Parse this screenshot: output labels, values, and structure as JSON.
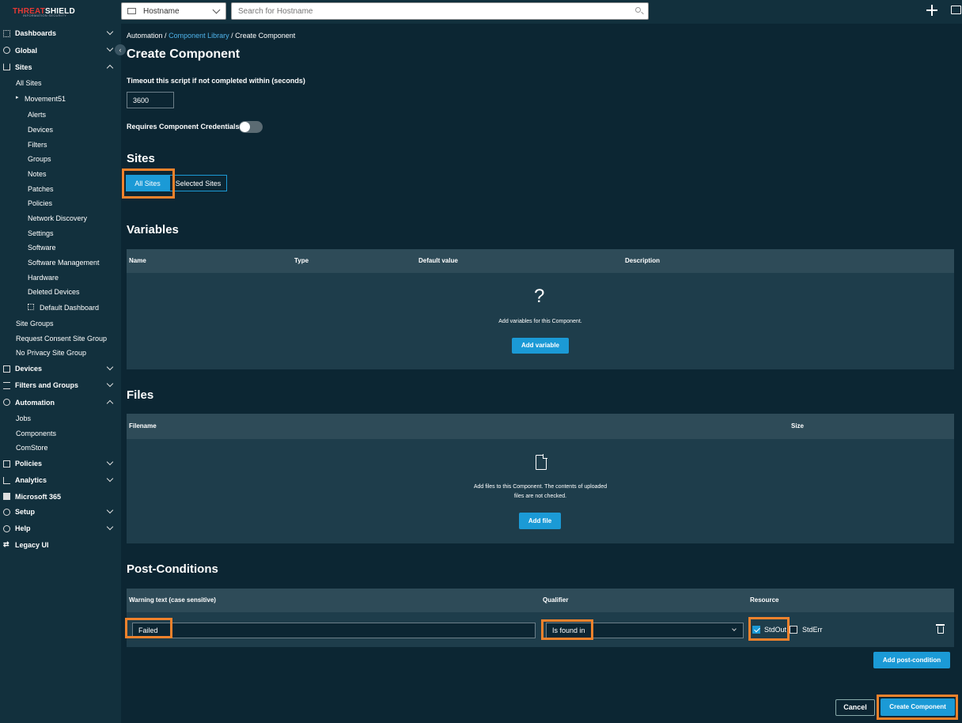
{
  "app": {
    "brand_strong": "SHIELD",
    "brand_prefix": "THREAT",
    "brand_tagline": "INFORMATION SECURITY"
  },
  "topbar": {
    "host_select": "Hostname",
    "search_placeholder": "Search for Hostname"
  },
  "sidebar": {
    "dashboards": "Dashboards",
    "global": "Global",
    "sites": "Sites",
    "all_sites": "All Sites",
    "site_name": "Movement51",
    "alerts": "Alerts",
    "devices_sub": "Devices",
    "filters": "Filters",
    "groups": "Groups",
    "notes": "Notes",
    "patches": "Patches",
    "policies_sub": "Policies",
    "network_discovery": "Network Discovery",
    "settings": "Settings",
    "software": "Software",
    "software_management": "Software Management",
    "hardware": "Hardware",
    "deleted_devices": "Deleted Devices",
    "default_dashboard": "Default Dashboard",
    "site_groups": "Site Groups",
    "request_consent": "Request Consent Site Group",
    "no_privacy": "No Privacy Site Group",
    "devices": "Devices",
    "filters_groups": "Filters and Groups",
    "automation": "Automation",
    "jobs": "Jobs",
    "components": "Components",
    "comstore": "ComStore",
    "policies": "Policies",
    "analytics": "Analytics",
    "m365": "Microsoft 365",
    "setup": "Setup",
    "help": "Help",
    "legacy": "Legacy UI"
  },
  "breadcrumb": {
    "root": "Automation",
    "sep": "/",
    "library": "Component Library",
    "current": "Create Component"
  },
  "page": {
    "title": "Create Component",
    "timeout_label": "Timeout this script if not completed within (seconds)",
    "timeout_value": "3600",
    "credentials_label": "Requires Component Credentials",
    "credentials_on": false
  },
  "sites": {
    "heading": "Sites",
    "all": "All Sites",
    "selected": "Selected Sites",
    "active": "all"
  },
  "variables": {
    "heading": "Variables",
    "columns": [
      "Name",
      "Type",
      "Default value",
      "Description"
    ],
    "empty_text": "Add variables for this Component.",
    "add_button": "Add variable"
  },
  "files": {
    "heading": "Files",
    "columns": [
      "Filename",
      "Size"
    ],
    "empty_line1": "Add files to this Component. The contents of uploaded",
    "empty_line2": "files are not checked.",
    "add_button": "Add file"
  },
  "post_conditions": {
    "heading": "Post-Conditions",
    "columns": [
      "Warning text (case sensitive)",
      "Qualifier",
      "Resource"
    ],
    "rows": [
      {
        "warning": "Failed",
        "qualifier": "Is found in",
        "stdout": true,
        "stderr": false
      }
    ],
    "stdout_label": "StdOut",
    "stderr_label": "StdErr",
    "add_button": "Add post-condition"
  },
  "footer": {
    "cancel": "Cancel",
    "create": "Create Component"
  },
  "colors": {
    "background": "#0c2633",
    "sidebar": "#12303d",
    "accent": "#1b9ad6",
    "highlight": "#f0822c"
  }
}
